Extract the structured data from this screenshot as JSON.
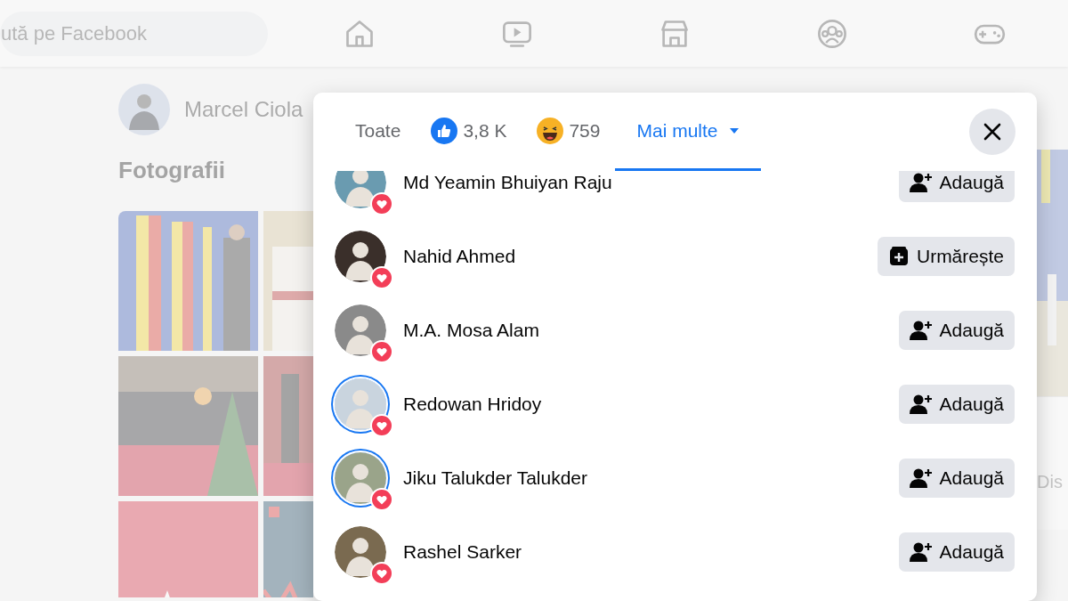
{
  "search": {
    "placeholder": "ută pe Facebook"
  },
  "profile": {
    "name": "Marcel Ciola"
  },
  "photos_section": {
    "title": "Fotografii"
  },
  "side_panel": {
    "text": "Dis"
  },
  "reactions_dialog": {
    "tabs": [
      {
        "kind": "all",
        "label": "Toate",
        "selected": false
      },
      {
        "kind": "like",
        "label": "3,8 K",
        "selected": false
      },
      {
        "kind": "haha",
        "label": "759",
        "selected": false
      },
      {
        "kind": "more",
        "label": "Mai multe",
        "selected": true
      }
    ],
    "people": [
      {
        "name": "Md Yeamin Bhuiyan Raju",
        "story": false,
        "reaction": {
          "kind": "love"
        },
        "action": {
          "kind": "add",
          "label": "Adaugă"
        }
      },
      {
        "name": "Nahid Ahmed",
        "story": false,
        "reaction": {
          "kind": "love"
        },
        "action": {
          "kind": "follow",
          "label": "Urmărește"
        }
      },
      {
        "name": "M.A. Mosa Alam",
        "story": false,
        "reaction": {
          "kind": "love"
        },
        "action": {
          "kind": "add",
          "label": "Adaugă"
        }
      },
      {
        "name": "Redowan Hridoy",
        "story": true,
        "reaction": {
          "kind": "love"
        },
        "action": {
          "kind": "add",
          "label": "Adaugă"
        }
      },
      {
        "name": "Jiku Talukder Talukder",
        "story": true,
        "reaction": {
          "kind": "love"
        },
        "action": {
          "kind": "add",
          "label": "Adaugă"
        }
      },
      {
        "name": "Rashel Sarker",
        "story": false,
        "reaction": {
          "kind": "love"
        },
        "action": {
          "kind": "add",
          "label": "Adaugă"
        }
      }
    ]
  }
}
